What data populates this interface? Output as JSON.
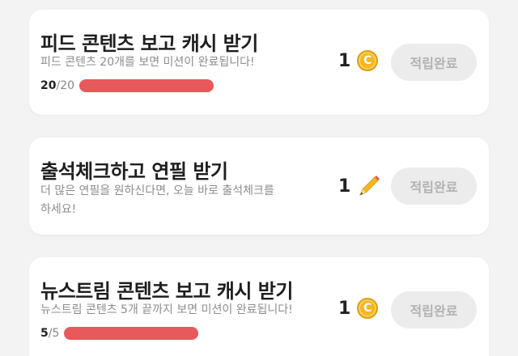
{
  "missions": [
    {
      "title": "피드 콘텐츠 보고 캐시 받기",
      "description": "피드 콘텐츠 20개를 보면 미션이 완료됩니다!",
      "progress_current": "20",
      "progress_total": "/20",
      "progress_fraction": 1.0,
      "reward_count": "1",
      "reward_icon": "cash-coin-icon",
      "coin_letter": "C",
      "button_label": "적립완료"
    },
    {
      "title": "출석체크하고 연필 받기",
      "description_line1": "더 많은 연필을 원하신다면, 오늘 바로 출석체크를",
      "description_line2": "하세요!",
      "reward_count": "1",
      "reward_icon": "pencil-icon",
      "button_label": "적립완료"
    },
    {
      "title": "뉴스트림 콘텐츠 보고 캐시 받기",
      "description": "뉴스트림 콘텐츠 5개 끝까지 보면 미션이 완료됩니다!",
      "progress_current": "5",
      "progress_total": "/5",
      "progress_fraction": 1.0,
      "reward_count": "1",
      "reward_icon": "cash-coin-icon",
      "coin_letter": "C",
      "button_label": "적립완료"
    }
  ],
  "colors": {
    "progress_fill": "#e8595b",
    "coin": "#f2b824",
    "button_bg": "#ececec",
    "button_text": "#b2b2b2"
  }
}
